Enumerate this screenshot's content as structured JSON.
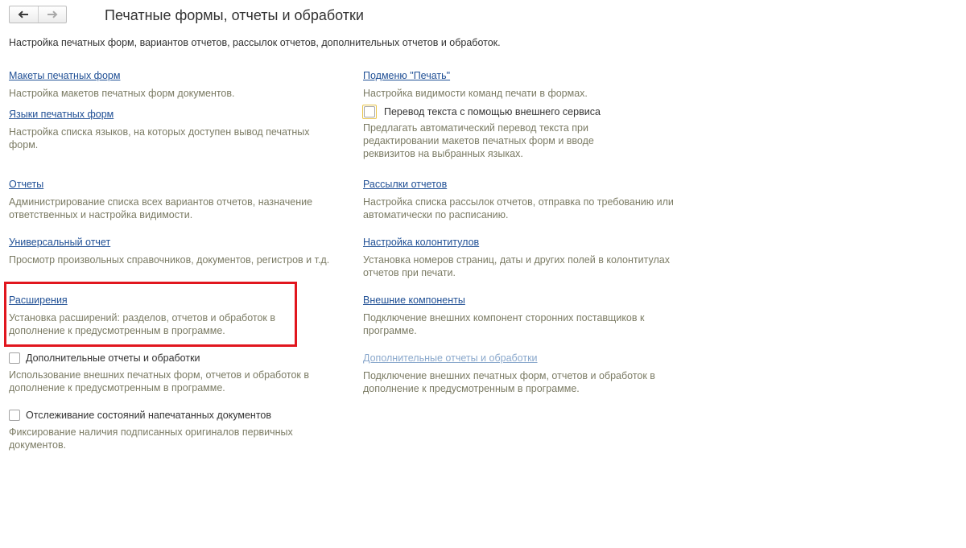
{
  "header": {
    "title": "Печатные формы, отчеты и обработки",
    "subtitle": "Настройка печатных форм, вариантов отчетов, рассылок отчетов, дополнительных отчетов и обработок."
  },
  "nav": {
    "back_icon": "arrow-left-icon",
    "forward_icon": "arrow-right-icon"
  },
  "left": {
    "print_templates": {
      "link": "Макеты печатных форм",
      "desc": "Настройка макетов печатных форм документов."
    },
    "print_languages": {
      "link": "Языки печатных форм",
      "desc_line1": "Настройка списка языков, на которых доступен вывод печатных",
      "desc_line2": "форм."
    },
    "reports": {
      "link": "Отчеты",
      "desc_line1": "Администрирование списка всех вариантов отчетов, назначение",
      "desc_line2": "ответственных и настройка видимости."
    },
    "universal_report": {
      "link": "Универсальный отчет",
      "desc": "Просмотр произвольных справочников, документов, регистров и т.д."
    },
    "extensions": {
      "link": "Расширения",
      "desc_line1": "Установка расширений: разделов, отчетов и обработок в",
      "desc_line2": "дополнение к предусмотренным в программе."
    },
    "additional_reports": {
      "label": "Дополнительные отчеты и обработки",
      "checked": false,
      "desc_line1": "Использование внешних печатных форм, отчетов и обработок в",
      "desc_line2": "дополнение к предусмотренным в программе."
    },
    "tracking": {
      "label": "Отслеживание состояний напечатанных документов",
      "checked": false,
      "desc_line1": "Фиксирование наличия подписанных оригиналов первичных",
      "desc_line2": "документов."
    }
  },
  "right": {
    "print_submenu": {
      "link": "Подменю \"Печать\"",
      "desc": "Настройка видимости команд печати в формах."
    },
    "translation": {
      "label": "Перевод текста с помощью внешнего сервиса",
      "checked": false,
      "desc_line1": "Предлагать автоматический перевод текста при",
      "desc_line2": "редактировании макетов печатных форм и вводе",
      "desc_line3": "реквизитов на выбранных языках."
    },
    "report_mailings": {
      "link": "Рассылки отчетов",
      "desc_line1": "Настройка списка рассылок отчетов, отправка по требованию или",
      "desc_line2": "автоматически по расписанию."
    },
    "headers_footers": {
      "link": "Настройка колонтитулов",
      "desc_line1": "Установка номеров страниц, даты и других полей в колонтитулах",
      "desc_line2": "отчетов при печати."
    },
    "external_components": {
      "link": "Внешние компоненты",
      "desc_line1": "Подключение внешних компонент сторонних поставщиков к",
      "desc_line2": "программе."
    },
    "additional_reports_link": {
      "link": "Дополнительные отчеты и обработки",
      "desc_line1": "Подключение внешних печатных форм, отчетов и обработок в",
      "desc_line2": "дополнение к предусмотренным в программе."
    }
  },
  "colors": {
    "link": "#1f4f95",
    "link_disabled": "#8aa8cc",
    "description": "#7b7b64",
    "highlight": "#e1161e",
    "focus": "#e8c44a"
  }
}
